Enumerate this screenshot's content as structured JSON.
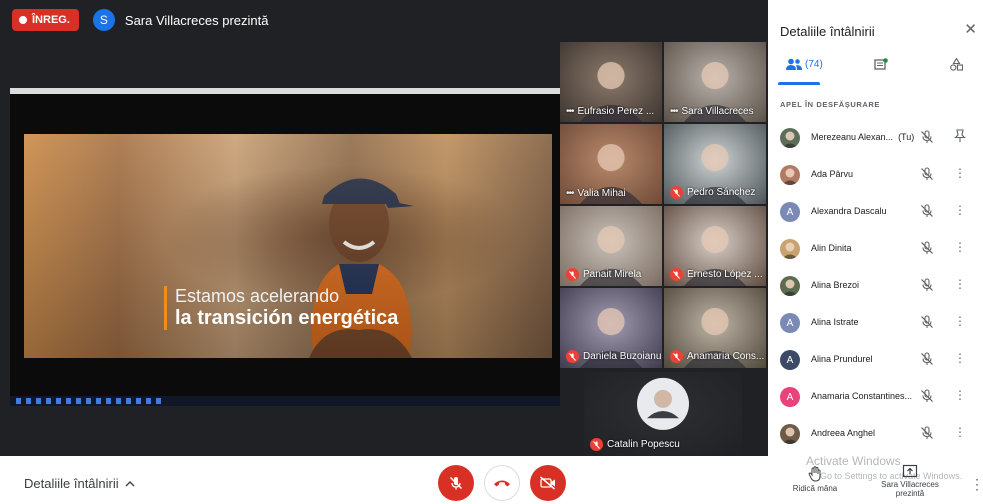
{
  "recording": {
    "label": "ÎNREG."
  },
  "presenter": {
    "initial": "S",
    "banner": "Sara Villacreces prezintă"
  },
  "presentation": {
    "line1": "Estamos acelerando",
    "line2": "la transición energética"
  },
  "tiles": [
    {
      "name": "Eufrasio Perez ...",
      "muted": false,
      "bg1": "#8c7a6b",
      "bg2": "#3c3430"
    },
    {
      "name": "Sara Villacreces",
      "muted": false,
      "bg1": "#b9b3ac",
      "bg2": "#5b5148"
    },
    {
      "name": "Valia Mihai",
      "muted": false,
      "bg1": "#b98a6b",
      "bg2": "#6e4a38"
    },
    {
      "name": "Pedro Sánchez",
      "muted": true,
      "bg1": "#cfd4d4",
      "bg2": "#4c5458"
    },
    {
      "name": "Panait Mirela",
      "muted": true,
      "bg1": "#c9c2bb",
      "bg2": "#7a6b60"
    },
    {
      "name": "Ernesto López ...",
      "muted": true,
      "bg1": "#d8cfc7",
      "bg2": "#5e4b40"
    },
    {
      "name": "Daniela Buzoianu",
      "muted": true,
      "bg1": "#a39cb2",
      "bg2": "#3f3b4d"
    },
    {
      "name": "Anamaria Cons...",
      "muted": true,
      "bg1": "#bdb5a6",
      "bg2": "#51483c"
    },
    {
      "name": "Catalin Popescu",
      "muted": true,
      "bg1": "#2d2f33",
      "bg2": "#202124"
    }
  ],
  "panel": {
    "title": "Detaliile întâlnirii",
    "people_count": "(74)",
    "section": "APEL ÎN DESFĂȘURARE",
    "participants": [
      {
        "name": "Merezeanu Alexan...",
        "suffix": "(Tu)",
        "initial": "",
        "color": "#5c6e5a",
        "photo": true,
        "action": "pin"
      },
      {
        "name": "Ada Pârvu",
        "suffix": "",
        "initial": "",
        "color": "#b07a63",
        "photo": true,
        "action": "more"
      },
      {
        "name": "Alexandra Dascalu",
        "suffix": "",
        "initial": "A",
        "color": "#7b8ab5",
        "photo": false,
        "action": "more"
      },
      {
        "name": "Alin Dinita",
        "suffix": "",
        "initial": "",
        "color": "#c7a36e",
        "photo": true,
        "action": "more"
      },
      {
        "name": "Alina Brezoi",
        "suffix": "",
        "initial": "",
        "color": "#5d6b4e",
        "photo": true,
        "action": "more"
      },
      {
        "name": "Alina Istrate",
        "suffix": "",
        "initial": "A",
        "color": "#7b8ab5",
        "photo": false,
        "action": "more"
      },
      {
        "name": "Alina Prundurel",
        "suffix": "",
        "initial": "A",
        "color": "#3c4a66",
        "photo": false,
        "action": "more"
      },
      {
        "name": "Anamaria Constantines...",
        "suffix": "",
        "initial": "A",
        "color": "#e8437a",
        "photo": false,
        "action": "more"
      },
      {
        "name": "Andreea Anghel",
        "suffix": "",
        "initial": "",
        "color": "#6f5a48",
        "photo": true,
        "action": "more"
      }
    ]
  },
  "bottom": {
    "details_label": "Detaliile întâlnirii",
    "raise_hand": "Ridică mâna",
    "present_label": "Sara Villacreces prezintă",
    "watermark_title": "Activate Windows",
    "watermark_sub": "Go to Settings to activate Windows."
  },
  "colors": {
    "accent": "#1a73e8",
    "danger": "#d93025",
    "stage": "#202124"
  }
}
